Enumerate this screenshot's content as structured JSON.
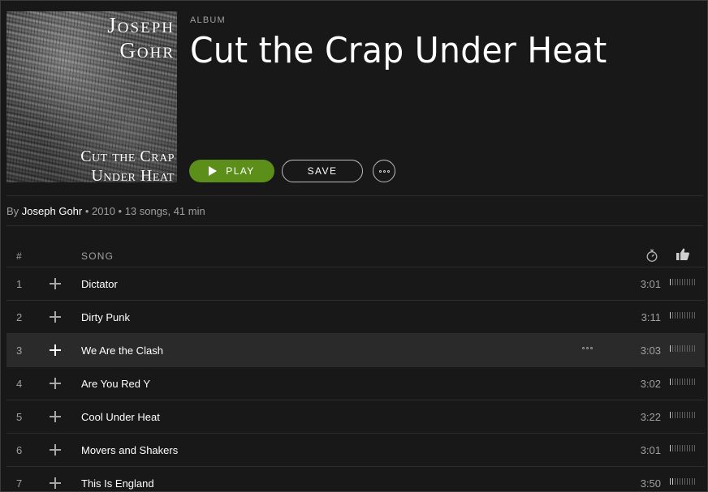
{
  "album": {
    "cover": {
      "artist_text": "Joseph Gohr",
      "title_text": "Cut the Crap Under Heat"
    },
    "label": "ALBUM",
    "title": "Cut the Crap Under Heat",
    "play_label": "PLAY",
    "save_label": "SAVE",
    "meta": {
      "by_prefix": "By ",
      "artist": "Joseph Gohr",
      "details": " • 2010 • 13 songs, 41 min"
    }
  },
  "tracklist": {
    "headers": {
      "number": "#",
      "song": "SONG",
      "duration_icon": "stopwatch-icon",
      "popularity_icon": "thumbs-up-icon"
    },
    "selected_index": 2,
    "tracks": [
      {
        "number": "1",
        "title": "Dictator",
        "duration": "3:01",
        "popularity": 1
      },
      {
        "number": "2",
        "title": "Dirty Punk",
        "duration": "3:11",
        "popularity": 1
      },
      {
        "number": "3",
        "title": "We Are the Clash",
        "duration": "3:03",
        "popularity": 1
      },
      {
        "number": "4",
        "title": "Are You Red Y",
        "duration": "3:02",
        "popularity": 1
      },
      {
        "number": "5",
        "title": "Cool Under Heat",
        "duration": "3:22",
        "popularity": 1
      },
      {
        "number": "6",
        "title": "Movers and Shakers",
        "duration": "3:01",
        "popularity": 1
      },
      {
        "number": "7",
        "title": "This Is England",
        "duration": "3:50",
        "popularity": 2
      }
    ]
  },
  "colors": {
    "background": "#181818",
    "play_button": "#5b8f1a",
    "selected_row": "#2a2a2a",
    "muted_text": "#a0a0a0"
  }
}
